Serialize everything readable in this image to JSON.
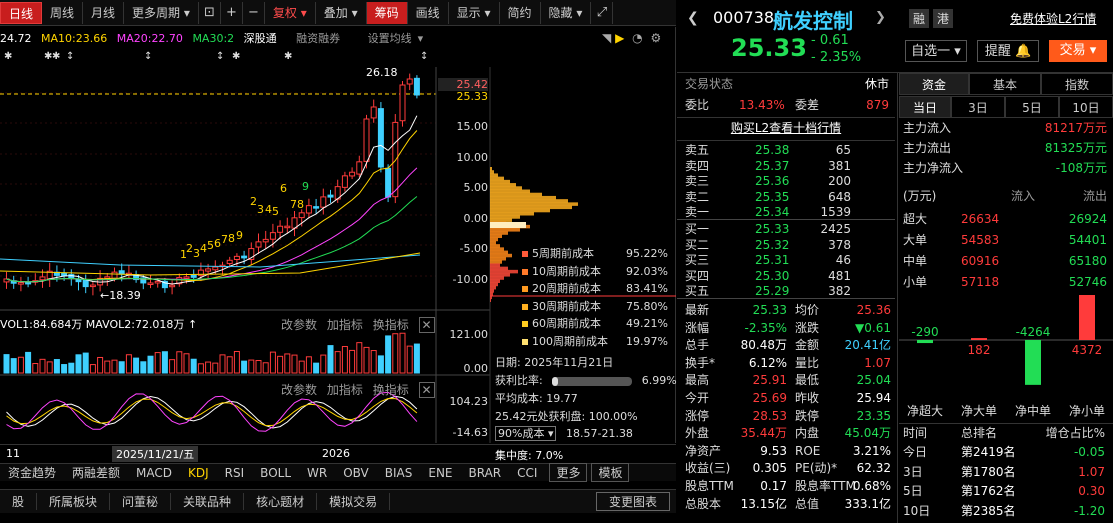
{
  "toolbar": {
    "tabs": [
      "日线",
      "周线",
      "月线",
      "更多周期"
    ],
    "right_items": [
      "复权",
      "叠加",
      "筹码",
      "画线",
      "显示",
      "简约",
      "隐藏"
    ]
  },
  "ma_legend": {
    "ma5": "24.72",
    "ma10": "MA10:23.66",
    "ma20": "MA20:22.70",
    "ma30": "MA30:2",
    "sub_a": "深股通",
    "sub_b": "融资融券",
    "sub_c": "设置均线"
  },
  "chart": {
    "y_ticks": [
      "25.42",
      "25.33",
      "15.00",
      "10.00",
      "5.00",
      "0.00",
      "-5.00",
      "-10.00"
    ],
    "high_label": "26.18",
    "low_label": "18.39",
    "seq_nums": [
      "1",
      "2",
      "3",
      "4",
      "5",
      "6",
      "7",
      "8",
      "9"
    ],
    "up_nums": [
      "2",
      "3",
      "4",
      "5",
      "6",
      "7",
      "8",
      "9"
    ],
    "vol_legend": "VOL1:84.684万 MAVOL2:72.018万",
    "vol_ticks": [
      "121.00",
      "0.00"
    ],
    "kdj_ticks": [
      "104.23",
      "-14.63"
    ],
    "sub_buttons": [
      "改参数",
      "加指标",
      "换指标"
    ],
    "x_labels": [
      "11",
      "2025/11/21/五",
      "2026"
    ]
  },
  "chip": {
    "rows": [
      {
        "label": "5周期前成本",
        "pct": "95.22%",
        "color": "#ff5a3a"
      },
      {
        "label": "10周期前成本",
        "pct": "92.03%",
        "color": "#ff7a2a"
      },
      {
        "label": "20周期前成本",
        "pct": "83.41%",
        "color": "#ff9a20"
      },
      {
        "label": "30周期前成本",
        "pct": "75.80%",
        "color": "#ffb020"
      },
      {
        "label": "60周期前成本",
        "pct": "49.21%",
        "color": "#ffcc20"
      },
      {
        "label": "100周期前成本",
        "pct": "19.97%",
        "color": "#ffe070"
      }
    ],
    "date": "日期: 2025年11月21日",
    "profit_label": "获利比率:",
    "profit_pct": "6.99%",
    "avg_cost": "平均成本: 19.77",
    "profit_at": "25.42元处获利盘: 100.00%",
    "cost_sel": "90%成本",
    "cost_range": "18.57-21.38",
    "concentration": "集中度: 7.0%"
  },
  "indicator_tabs": [
    "资金趋势",
    "两融差额",
    "MACD",
    "KDJ",
    "RSI",
    "BOLL",
    "WR",
    "OBV",
    "BIAS",
    "ENE",
    "BRAR",
    "CCI",
    "更多",
    "模板"
  ],
  "bottom_tabs": [
    "股",
    "所属板块",
    "问董秘",
    "关联品种",
    "核心题材",
    "模拟交易"
  ],
  "bottom_right": "变更图表",
  "stock": {
    "code": "000738",
    "name": "航发控制",
    "price": "25.33",
    "chg": "- 0.61",
    "pct": "- 2.35%",
    "tags": [
      "融",
      "港"
    ],
    "l2": "免费体验L2行情",
    "btns": [
      "自选一",
      "提醒",
      "交易"
    ]
  },
  "status": {
    "label": "交易状态",
    "value": "休市"
  },
  "weibi": {
    "l1": "委比",
    "v1": "13.43%",
    "l2": "委差",
    "v2": "879"
  },
  "buy_l2": "购买L2查看十档行情",
  "asks": [
    {
      "n": "卖五",
      "p": "25.38",
      "v": "65"
    },
    {
      "n": "卖四",
      "p": "25.37",
      "v": "381"
    },
    {
      "n": "卖三",
      "p": "25.36",
      "v": "200"
    },
    {
      "n": "卖二",
      "p": "25.35",
      "v": "648"
    },
    {
      "n": "卖一",
      "p": "25.34",
      "v": "1539"
    }
  ],
  "bids": [
    {
      "n": "买一",
      "p": "25.33",
      "v": "2425"
    },
    {
      "n": "买二",
      "p": "25.32",
      "v": "378"
    },
    {
      "n": "买三",
      "p": "25.31",
      "v": "46"
    },
    {
      "n": "买四",
      "p": "25.30",
      "v": "481"
    },
    {
      "n": "买五",
      "p": "25.29",
      "v": "382"
    }
  ],
  "quote": [
    {
      "l1": "最新",
      "v1": "25.33",
      "c1": "grn",
      "l2": "均价",
      "v2": "25.36",
      "c2": "red"
    },
    {
      "l1": "涨幅",
      "v1": "-2.35%",
      "c1": "grn",
      "l2": "涨跌",
      "v2": "▼0.61",
      "c2": "grn"
    },
    {
      "l1": "总手",
      "v1": "80.48万",
      "c1": "wht",
      "l2": "金额",
      "v2": "20.41亿",
      "c2": "cyan"
    },
    {
      "l1": "换手*",
      "v1": "6.12%",
      "c1": "wht",
      "l2": "量比",
      "v2": "1.07",
      "c2": "red"
    },
    {
      "l1": "最高",
      "v1": "25.91",
      "c1": "red",
      "l2": "最低",
      "v2": "25.04",
      "c2": "grn"
    },
    {
      "l1": "今开",
      "v1": "25.69",
      "c1": "red",
      "l2": "昨收",
      "v2": "25.94",
      "c2": "wht"
    },
    {
      "l1": "涨停",
      "v1": "28.53",
      "c1": "red",
      "l2": "跌停",
      "v2": "23.35",
      "c2": "grn"
    },
    {
      "l1": "外盘",
      "v1": "35.44万",
      "c1": "red",
      "l2": "内盘",
      "v2": "45.04万",
      "c2": "grn"
    },
    {
      "l1": "净资产",
      "v1": "9.53",
      "c1": "wht",
      "l2": "ROE",
      "v2": "3.21%",
      "c2": "wht"
    },
    {
      "l1": "收益(三)",
      "v1": "0.305",
      "c1": "wht",
      "l2": "PE(动)*",
      "v2": "62.32",
      "c2": "wht"
    },
    {
      "l1": "股息TTM",
      "v1": "0.17",
      "c1": "wht",
      "l2": "股息率TTM",
      "v2": "0.68%",
      "c2": "wht"
    },
    {
      "l1": "总股本",
      "v1": "13.15亿",
      "c1": "wht",
      "l2": "总值",
      "v2": "333.1亿",
      "c2": "wht"
    }
  ],
  "fund": {
    "tabs": [
      "资金",
      "基本",
      "指数"
    ],
    "periods": [
      "当日",
      "3日",
      "5日",
      "10日"
    ],
    "main": [
      {
        "a": "主力流入",
        "b": "81217万元",
        "c": "red"
      },
      {
        "a": "主力流出",
        "b": "81325万元",
        "c": "grn"
      },
      {
        "a": "主力净流入",
        "b": "-108万元",
        "c": "grn"
      }
    ],
    "hdr": {
      "a": "(万元)",
      "b": "流入",
      "c": "流出"
    },
    "rows": [
      {
        "a": "超大",
        "b": "26634",
        "c": "26924"
      },
      {
        "a": "大单",
        "b": "54583",
        "c": "54401"
      },
      {
        "a": "中单",
        "b": "60916",
        "c": "65180"
      },
      {
        "a": "小单",
        "b": "57118",
        "c": "52746"
      }
    ],
    "bars": [
      {
        "label": "净超大",
        "value": -290
      },
      {
        "label": "净大单",
        "value": 182
      },
      {
        "label": "净中单",
        "value": -4264
      },
      {
        "label": "净小单",
        "value": 4372
      }
    ],
    "rank_hdr": {
      "a": "时间",
      "b": "总排名",
      "c": "增仓占比%"
    },
    "rank": [
      {
        "a": "今日",
        "b": "第2419名",
        "c": "-0.05"
      },
      {
        "a": "3日",
        "b": "第1780名",
        "c": "1.07"
      },
      {
        "a": "5日",
        "b": "第1762名",
        "c": "0.30"
      },
      {
        "a": "10日",
        "b": "第2385名",
        "c": "-1.20"
      }
    ]
  }
}
